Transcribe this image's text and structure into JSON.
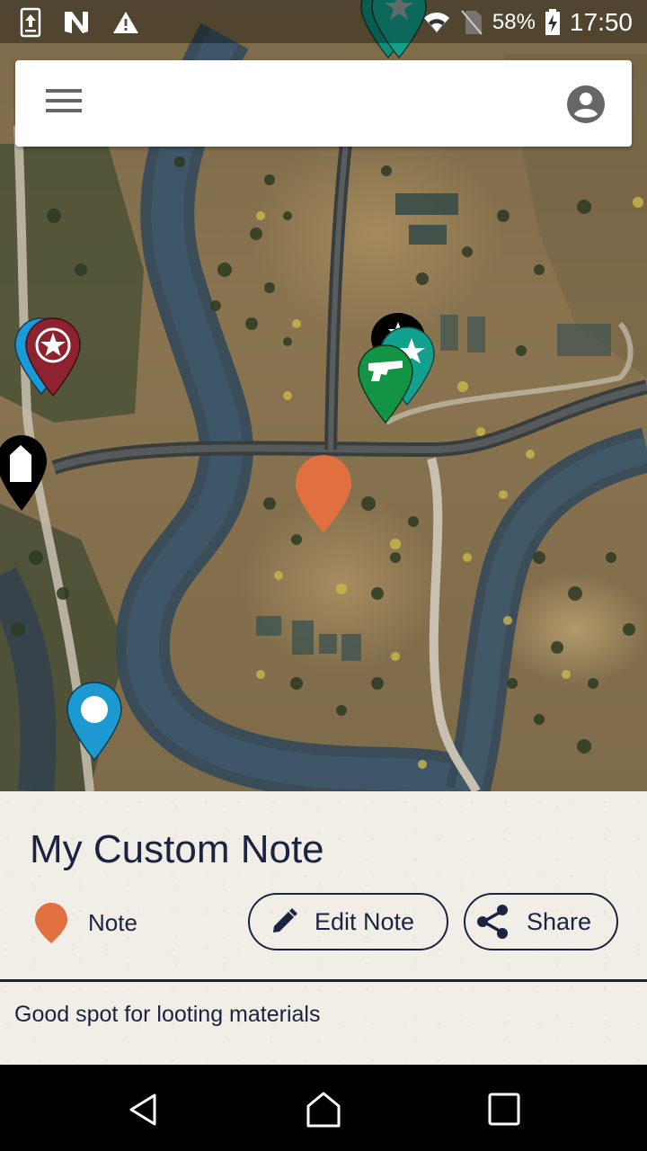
{
  "status_bar": {
    "left_icons": [
      "upload-sync-icon",
      "n-app-icon",
      "warning-icon"
    ],
    "wifi_icon": "wifi-icon",
    "signal_icon": "no-sim-icon",
    "battery_percent": "58%",
    "battery_icon": "battery-charging-icon",
    "time": "17:50"
  },
  "top_bar": {
    "menu_icon": "hamburger-menu-icon",
    "account_icon": "account-circle-icon"
  },
  "map": {
    "markers": [
      {
        "name": "teal-star-marker-top",
        "color": "#0f9b86",
        "icon": "star-icon"
      },
      {
        "name": "blue-marker-left",
        "color": "#1a9ad6",
        "icon": "none"
      },
      {
        "name": "red-star-badge-marker",
        "color": "#8f2230",
        "icon": "star-badge-icon"
      },
      {
        "name": "black-house-marker",
        "color": "#000000",
        "icon": "house-icon"
      },
      {
        "name": "black-marker-center",
        "color": "#000000",
        "icon": "star-icon"
      },
      {
        "name": "teal-star-marker-center",
        "color": "#14a08e",
        "icon": "star-icon"
      },
      {
        "name": "green-gun-marker",
        "color": "#129444",
        "icon": "pistol-icon"
      },
      {
        "name": "orange-note-marker",
        "color": "#e07040",
        "icon": "none"
      },
      {
        "name": "blue-dot-marker",
        "color": "#1c99d0",
        "icon": "dot-icon"
      }
    ]
  },
  "note": {
    "title": "My Custom Note",
    "category_label": "Note",
    "category_color": "#e07040",
    "edit_label": "Edit Note",
    "share_label": "Share",
    "body": "Good spot for looting materials"
  },
  "colors": {
    "text_primary": "#1b2340",
    "sheet_background": "#f0eee6"
  },
  "nav_bar": {
    "back_icon": "back-triangle-icon",
    "home_icon": "home-icon",
    "recents_icon": "recents-square-icon"
  }
}
